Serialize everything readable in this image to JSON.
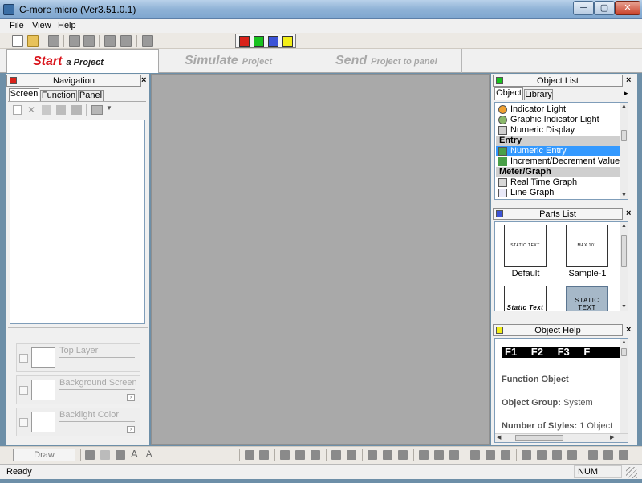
{
  "window": {
    "title": "C-more micro (Ver3.51.0.1)",
    "min": "─",
    "max": "▢",
    "close": "✕"
  },
  "menu": [
    "File",
    "View",
    "Help"
  ],
  "steps": [
    {
      "big": "Start",
      "small": "a Project"
    },
    {
      "big": "Simulate",
      "small": "Project"
    },
    {
      "big": "Send",
      "small": "Project to panel"
    }
  ],
  "toolbar": {
    "colors": [
      "#d9231a",
      "#19c21e",
      "#3b53d6",
      "#f2ee18"
    ]
  },
  "navigation": {
    "title": "Navigation",
    "color": "#d9231a",
    "close": "×",
    "tabs": [
      "Screen",
      "Function",
      "Panel"
    ],
    "layers": [
      {
        "label": "Top Layer"
      },
      {
        "label": "Background Screen",
        "more": "›"
      },
      {
        "label": "Backlight Color",
        "more": "›"
      }
    ],
    "draw_label": "Draw"
  },
  "object_list": {
    "title": "Object List",
    "color": "#19c21e",
    "close": "×",
    "tabs": [
      "Object",
      "Library"
    ],
    "more": "▸",
    "rows": [
      {
        "type": "item",
        "label": "Indicator Light",
        "icon": "indicator-light-icon",
        "color": "#f0a030"
      },
      {
        "type": "item",
        "label": "Graphic Indicator Light",
        "icon": "graphic-indicator-icon",
        "color": "#8ab86a"
      },
      {
        "type": "item",
        "label": "Numeric Display",
        "icon": "numeric-display-icon",
        "color": "#cfcfcf"
      },
      {
        "type": "group",
        "label": "Entry"
      },
      {
        "type": "item",
        "label": "Numeric Entry",
        "icon": "numeric-entry-icon",
        "color": "#49a048",
        "selected": true
      },
      {
        "type": "item",
        "label": "Increment/Decrement Value",
        "icon": "increment-icon",
        "color": "#49a048"
      },
      {
        "type": "group",
        "label": "Meter/Graph"
      },
      {
        "type": "item",
        "label": "Real Time Graph",
        "icon": "realtime-graph-icon",
        "color": "#d8d8d8"
      },
      {
        "type": "item",
        "label": "Line Graph",
        "icon": "line-graph-icon",
        "color": "#e8e8f8"
      }
    ]
  },
  "parts_list": {
    "title": "Parts List",
    "color": "#3b53d6",
    "close": "×",
    "parts": [
      {
        "label": "Default",
        "thumb_text": "STATIC TEXT"
      },
      {
        "label": "Sample-1",
        "thumb_text": "MAX 101"
      },
      {
        "label": "",
        "thumb_text": "Static Text"
      },
      {
        "label": "",
        "thumb_text": "STATIC TEXT"
      }
    ]
  },
  "object_help": {
    "title": "Object Help",
    "color": "#f2ee18",
    "close": "×",
    "fkeys": [
      "F1",
      "F2",
      "F3",
      "F"
    ],
    "function_object": "Function Object",
    "group_label": "Object Group:",
    "group_value": "System",
    "styles_label": "Number of Styles:",
    "styles_value": "1 Object"
  },
  "status": {
    "ready": "Ready",
    "num": "NUM"
  }
}
